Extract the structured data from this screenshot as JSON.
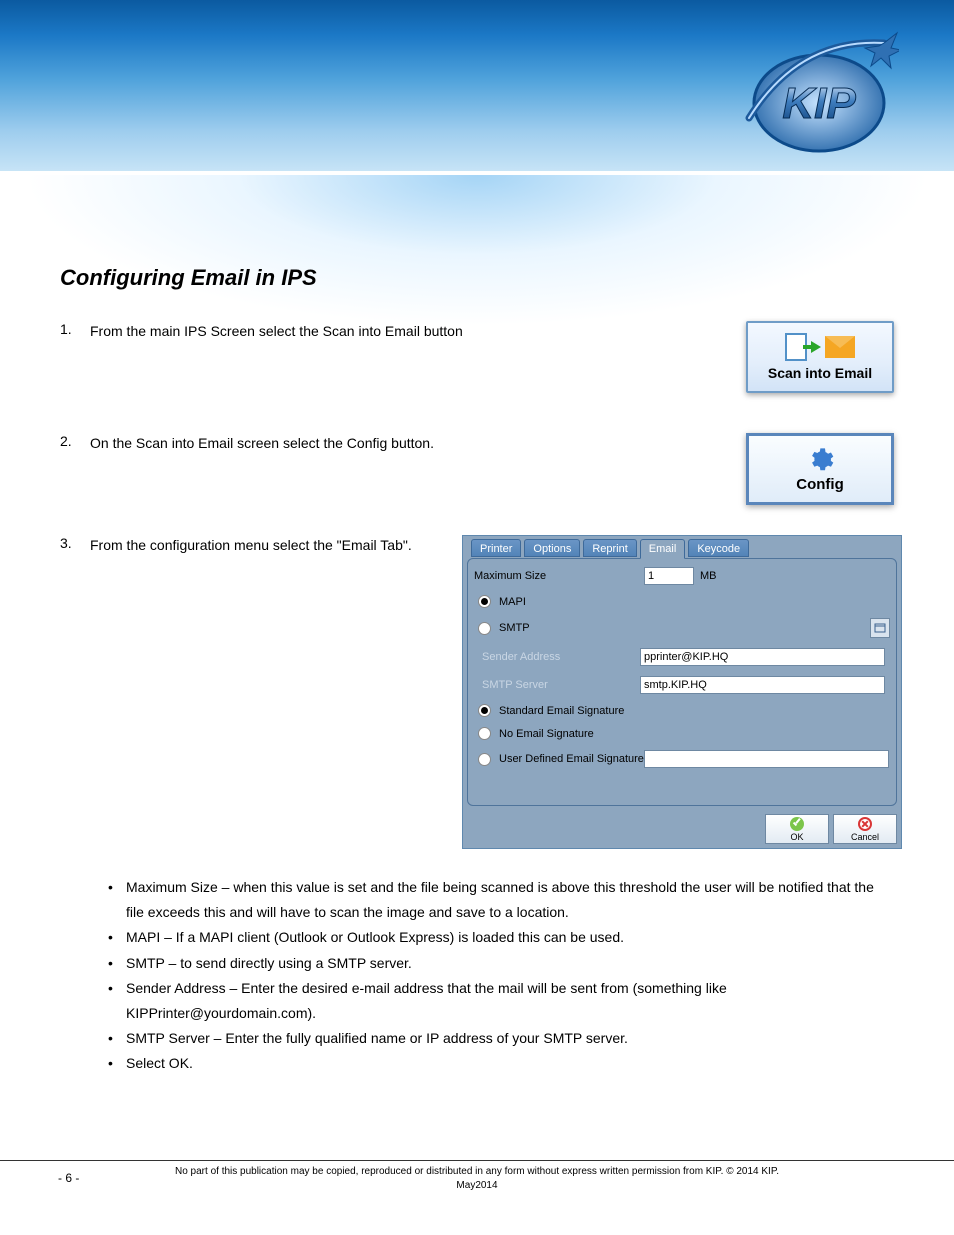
{
  "header": {
    "logo_alt": "KIP"
  },
  "content": {
    "title": "Configuring Email in IPS",
    "steps": {
      "s1": {
        "num": "1.",
        "text": "From the main IPS Screen select the Scan into Email button"
      },
      "s2": {
        "num": "2.",
        "text": "On the Scan into Email screen select the Config button."
      },
      "s3": {
        "num": "3.",
        "text": "From the configuration menu select the \"Email Tab\"."
      }
    },
    "bullets": {
      "b1": "Maximum Size – when this value is set and the file being scanned is above this threshold the user will be notified that the file exceeds this and will have to scan the image and save to a location.",
      "b2": "MAPI – If a MAPI client (Outlook or Outlook Express) is loaded this can be used.",
      "b3": "SMTP – to send directly using a SMTP server.",
      "b4": "Sender Address – Enter the desired e-mail address that the mail will be sent from (something like KIPPrinter@yourdomain.com).",
      "b5": "SMTP Server – Enter the fully qualified name or IP address of your SMTP server.",
      "b6": "Select OK."
    }
  },
  "scan_email_btn": {
    "label": "Scan into Email"
  },
  "config_btn": {
    "label": "Config"
  },
  "dialog": {
    "tabs": {
      "t1": "Printer",
      "t2": "Options",
      "t3": "Reprint",
      "t4": "Email",
      "t5": "Keycode"
    },
    "max_size_label": "Maximum Size",
    "max_size_value": "1",
    "max_size_unit": "MB",
    "mapi": "MAPI",
    "smtp": "SMTP",
    "sender_addr_label": "Sender Address",
    "sender_addr_value": "pprinter@KIP.HQ",
    "smtp_server_label": "SMTP Server",
    "smtp_server_value": "smtp.KIP.HQ",
    "sig_std": "Standard Email Signature",
    "sig_none": "No Email Signature",
    "sig_user": "User Defined Email Signature",
    "sig_user_value": "",
    "ok": "OK",
    "cancel": "Cancel"
  },
  "footer": {
    "pagenum": "- 6 -",
    "line1_prefix": "No part of this publication may be copied, reproduced or distributed in any form without express written permission from KIP. ",
    "line1_copyright": " 2014 KIP.",
    "line2": "May2014"
  }
}
